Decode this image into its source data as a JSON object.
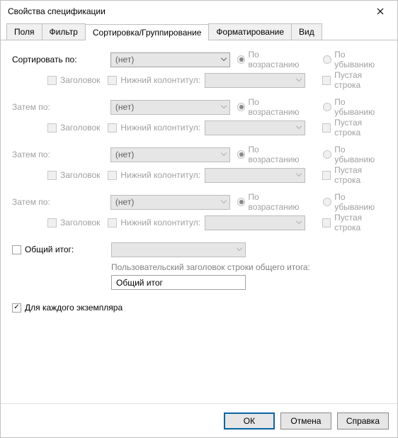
{
  "window": {
    "title": "Свойства спецификации"
  },
  "tabs": {
    "items": [
      {
        "label": "Поля"
      },
      {
        "label": "Фильтр"
      },
      {
        "label": "Сортировка/Группирование"
      },
      {
        "label": "Форматирование"
      },
      {
        "label": "Вид"
      }
    ],
    "active_index": 2
  },
  "sort": {
    "primary_label": "Сортировать по:",
    "then_label": "Затем по:",
    "header_label": "Заголовок",
    "footer_label": "Нижний колонтитул:",
    "blank_label": "Пустая строка",
    "asc_label": "По возрастанию",
    "desc_label": "По убыванию",
    "none_value": "(нет)",
    "groups": [
      {
        "value": "(нет)"
      },
      {
        "value": "(нет)"
      },
      {
        "value": "(нет)"
      },
      {
        "value": "(нет)"
      }
    ]
  },
  "grand_total": {
    "checkbox_label": "Общий итог:",
    "caption": "Пользовательский заголовок строки общего итога:",
    "input_value": "Общий итог"
  },
  "per_instance": {
    "label": "Для каждого экземпляра",
    "checked": true
  },
  "buttons": {
    "ok": "ОК",
    "cancel": "Отмена",
    "help": "Справка"
  }
}
